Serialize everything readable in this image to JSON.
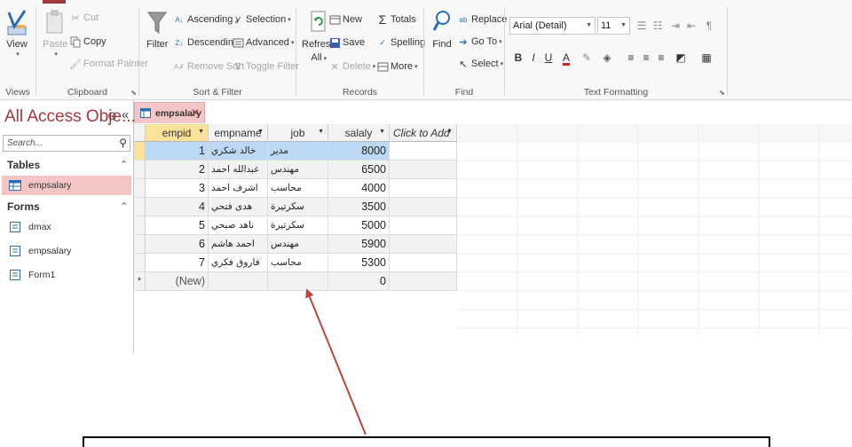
{
  "ribbon": {
    "views": {
      "view_label": "View",
      "group_label": "Views"
    },
    "clipboard": {
      "paste_label": "Paste",
      "cut_label": "Cut",
      "copy_label": "Copy",
      "format_painter_label": "Format Painter",
      "group_label": "Clipboard"
    },
    "sort_filter": {
      "filter_label": "Filter",
      "ascending_label": "Ascending",
      "descending_label": "Descending",
      "remove_sort_label": "Remove Sort",
      "selection_label": "Selection",
      "advanced_label": "Advanced",
      "toggle_filter_label": "Toggle Filter",
      "group_label": "Sort & Filter"
    },
    "records": {
      "refresh_label": "Refresh",
      "refresh_all_label": "All",
      "new_label": "New",
      "save_label": "Save",
      "delete_label": "Delete",
      "totals_label": "Totals",
      "spelling_label": "Spelling",
      "more_label": "More",
      "group_label": "Records"
    },
    "find": {
      "find_label": "Find",
      "replace_label": "Replace",
      "goto_label": "Go To",
      "select_label": "Select",
      "group_label": "Find"
    },
    "text_formatting": {
      "font_name": "Arial (Detail)",
      "font_size": "11",
      "bold": "B",
      "italic": "I",
      "underline": "U",
      "font_color_glyph": "A",
      "group_label": "Text Formatting"
    }
  },
  "nav": {
    "title": "All Access Obje...",
    "search_placeholder": "Search...",
    "sections": [
      {
        "label": "Tables",
        "items": [
          {
            "label": "empsalary",
            "selected": true
          }
        ]
      },
      {
        "label": "Forms",
        "items": [
          {
            "label": "dmax"
          },
          {
            "label": "empsalary"
          },
          {
            "label": "Form1"
          }
        ]
      }
    ]
  },
  "document_tab": {
    "label": "empsalary"
  },
  "table": {
    "columns": [
      "empid",
      "empname",
      "job",
      "salaly",
      "Click to Add"
    ],
    "rows": [
      {
        "empid": "1",
        "empname": "خالد شكري",
        "job": "مدير",
        "salaly": "8000"
      },
      {
        "empid": "2",
        "empname": "عبدالله احمد",
        "job": "مهندس",
        "salaly": "6500"
      },
      {
        "empid": "3",
        "empname": "اشرف احمد",
        "job": "محاسب",
        "salaly": "4000"
      },
      {
        "empid": "4",
        "empname": "هدى فتحي",
        "job": "سكرتيرة",
        "salaly": "3500"
      },
      {
        "empid": "5",
        "empname": "ناهد صبحي",
        "job": "سكرتيرة",
        "salaly": "5000"
      },
      {
        "empid": "6",
        "empname": "احمد هاشم",
        "job": "مهندس",
        "salaly": "5900"
      },
      {
        "empid": "7",
        "empname": "فاروق فكري",
        "job": "محاسب",
        "salaly": "5300"
      }
    ],
    "new_row": {
      "selector": "*",
      "empid": "(New)",
      "salaly": "0"
    }
  },
  "colors": {
    "accent": "#a4373a",
    "selection_blue": "#bcd8f5",
    "header_yellow": "#fbe29a",
    "arrow": "#b5473f"
  }
}
